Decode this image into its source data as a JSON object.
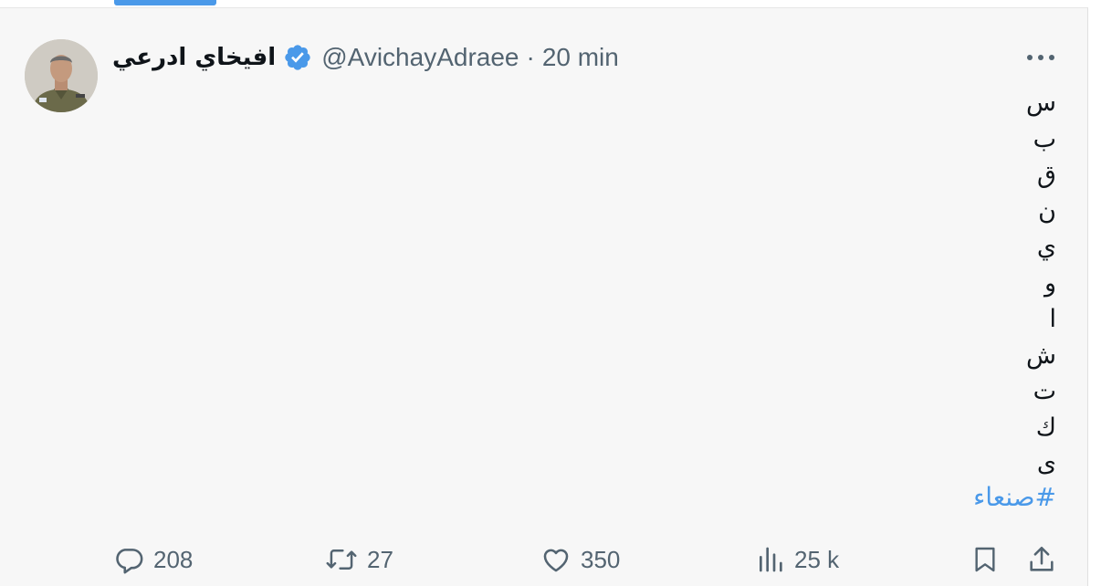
{
  "tweet": {
    "author": {
      "display_name": "افيخاي ادرعي",
      "handle": "@AvichayAdraee",
      "verified": true
    },
    "separator": "·",
    "time": "20 min",
    "body_chars": [
      "س",
      "ب",
      "ق",
      "ن",
      "ي",
      "و",
      "ا",
      "ش",
      "ت",
      "ك",
      "ى"
    ],
    "hashtag": "#صنعاء",
    "stats": {
      "replies": "208",
      "retweets": "27",
      "likes": "350",
      "views": "25 k"
    }
  },
  "colors": {
    "accent": "#4a99e9",
    "text_primary": "#0f1419",
    "text_secondary": "#536471",
    "background": "#f7f7f7"
  },
  "icons": {
    "reply": "speech-bubble-icon",
    "retweet": "retweet-arrows-icon",
    "like": "heart-icon",
    "views": "bar-chart-icon",
    "bookmark": "bookmark-icon",
    "share": "share-upload-icon",
    "more": "ellipsis-icon",
    "verified": "verified-badge-icon"
  }
}
